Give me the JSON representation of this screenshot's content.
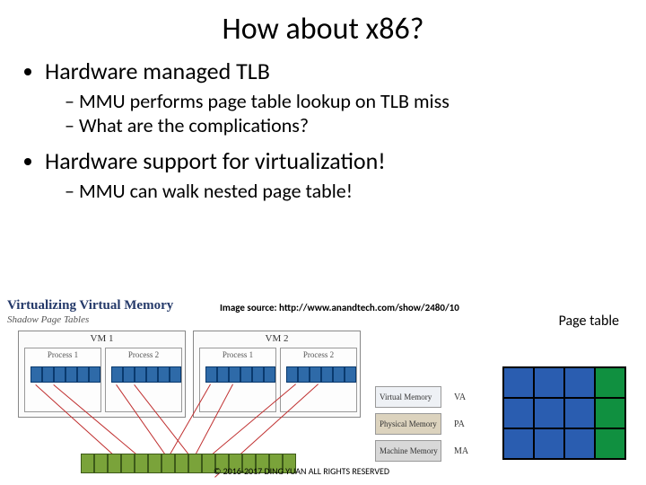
{
  "title": "How about x86?",
  "bullets": {
    "b1": "Hardware managed TLB",
    "b1s1": "MMU performs page table lookup on TLB miss",
    "b1s2": "What are the complications?",
    "b2": "Hardware support for virtualization!",
    "b2s1": "MMU can walk nested page table!"
  },
  "diagram": {
    "vvm_title": "Virtualizing Virtual Memory",
    "vvm_sub": "Shadow Page Tables",
    "img_src": "Image source: http://www.anandtech.com/show/2480/10",
    "pt_label": "Page table",
    "vm1": "VM 1",
    "vm2": "VM 2",
    "proc1": "Process 1",
    "proc2": "Process 2",
    "legend": {
      "virt": "Virtual Memory",
      "virt_tag": "VA",
      "phys": "Physical Memory",
      "phys_tag": "PA",
      "mach": "Machine Memory",
      "mach_tag": "MA"
    }
  },
  "copyright": "© 2016-2017 DING YUAN ALL RIGHTS RESERVED"
}
